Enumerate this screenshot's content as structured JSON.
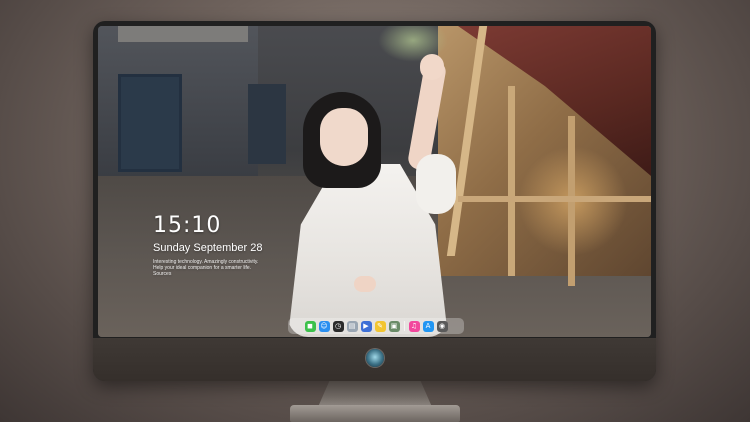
{
  "lockscreen": {
    "time": "15:10",
    "date": "Sunday September 28",
    "tagline": "Interesting technology. Amazingly constructivity. Help your ideal companion for a smarter life. Sources"
  },
  "dock": {
    "items": [
      {
        "icon": "messages-icon",
        "color": "#3cc14b",
        "glyph": "◼"
      },
      {
        "icon": "finder-icon",
        "color": "#2a8ff0",
        "glyph": "☺"
      },
      {
        "icon": "clock-icon",
        "color": "#2b2b2b",
        "glyph": "◷"
      },
      {
        "icon": "preview-icon",
        "color": "#9aa6b3",
        "glyph": "▤"
      },
      {
        "icon": "clapper-icon",
        "color": "#3d6fd6",
        "glyph": "▶"
      },
      {
        "icon": "notes-icon",
        "color": "#f2c531",
        "glyph": "✎"
      },
      {
        "icon": "image-capture-icon",
        "color": "#6a8b68",
        "glyph": "▣"
      },
      {
        "icon": "music-icon",
        "color": "#f2489d",
        "glyph": "♫"
      },
      {
        "icon": "app-store-icon",
        "color": "#2196f3",
        "glyph": "A"
      },
      {
        "icon": "camera-icon",
        "color": "#5a5a5a",
        "glyph": "◉"
      }
    ]
  }
}
